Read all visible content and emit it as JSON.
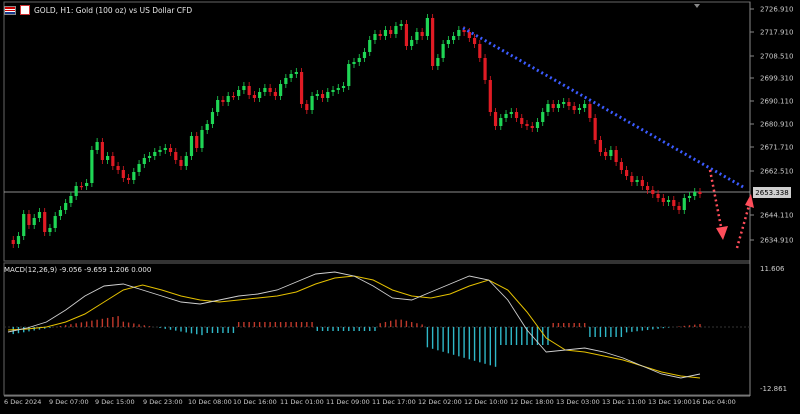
{
  "header": {
    "title": "GOLD, H1:  Gold (100 oz) vs US Dollar CFD",
    "icons": [
      "flag-icon",
      "instrument-icon"
    ]
  },
  "price_axis": {
    "labels": [
      "2726.910",
      "2717.910",
      "2708.510",
      "2699.310",
      "2690.110",
      "2680.910",
      "2671.710",
      "2662.510",
      "2644.110",
      "2634.910"
    ],
    "current_price": "2653.338"
  },
  "macd": {
    "label": "MACD(12,26,9) -9.056 -9.659 1.206 0.000",
    "axis_top": "11.606",
    "axis_bottom": "-12.861"
  },
  "time_axis": {
    "labels": [
      "6 Dec 2024",
      "9 Dec 07:00",
      "9 Dec 15:00",
      "9 Dec 23:00",
      "10 Dec 08:00",
      "10 Dec 16:00",
      "11 Dec 01:00",
      "11 Dec 09:00",
      "11 Dec 17:00",
      "12 Dec 02:00",
      "12 Dec 10:00",
      "12 Dec 18:00",
      "13 Dec 03:00",
      "13 Dec 11:00",
      "13 Dec 19:00",
      "16 Dec 04:00"
    ]
  },
  "colors": {
    "bull": "#1fd655",
    "bear": "#e01b24",
    "trendline": "#3b5bff",
    "arrow": "#ff4d5a",
    "macd_signal": "#e5c100",
    "macd_line": "#d0d0d0",
    "hist_pos": "#c0392b",
    "hist_neg": "#2fb8c8"
  }
}
